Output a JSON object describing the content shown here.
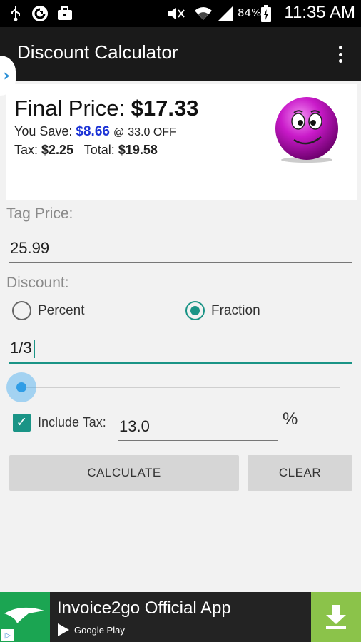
{
  "status_bar": {
    "battery_percent": "84%",
    "time": "11:35 AM",
    "icons": [
      "usb-icon",
      "sync-icon",
      "briefcase-icon",
      "mute-icon",
      "wifi-icon",
      "signal-icon",
      "battery-charging-icon"
    ]
  },
  "app_bar": {
    "title": "Discount Calculator",
    "overflow_icon": "more-vert-icon"
  },
  "result": {
    "final_label": "Final Price:",
    "final_value": "$17.33",
    "save_label": "You Save:",
    "save_value": "$8.66",
    "at_text": "@",
    "off_text": "33.0 OFF",
    "tax_label": "Tax:",
    "tax_value": "$2.25",
    "total_label": "Total:",
    "total_value": "$19.58",
    "emoji_icon": "smiley-icon"
  },
  "form": {
    "tag_price_label": "Tag Price:",
    "tag_price_value": "25.99",
    "discount_label": "Discount:",
    "radio_percent_label": "Percent",
    "radio_fraction_label": "Fraction",
    "selected_discount_mode": "Fraction",
    "discount_value": "1/3",
    "slider_level": 0,
    "include_tax_label": "Include Tax:",
    "include_tax_checked": true,
    "tax_rate_value": "13.0",
    "percent_symbol": "%",
    "calculate_label": "CALCULATE",
    "clear_label": "CLEAR"
  },
  "ad": {
    "title": "Invoice2go Official App",
    "store_label": "Google Play",
    "download_icon": "download-icon"
  },
  "colors": {
    "accent": "#1a9486",
    "save_amount": "#1c33d6",
    "slider": "#2f9de6",
    "ad_download": "#8bc34a"
  }
}
